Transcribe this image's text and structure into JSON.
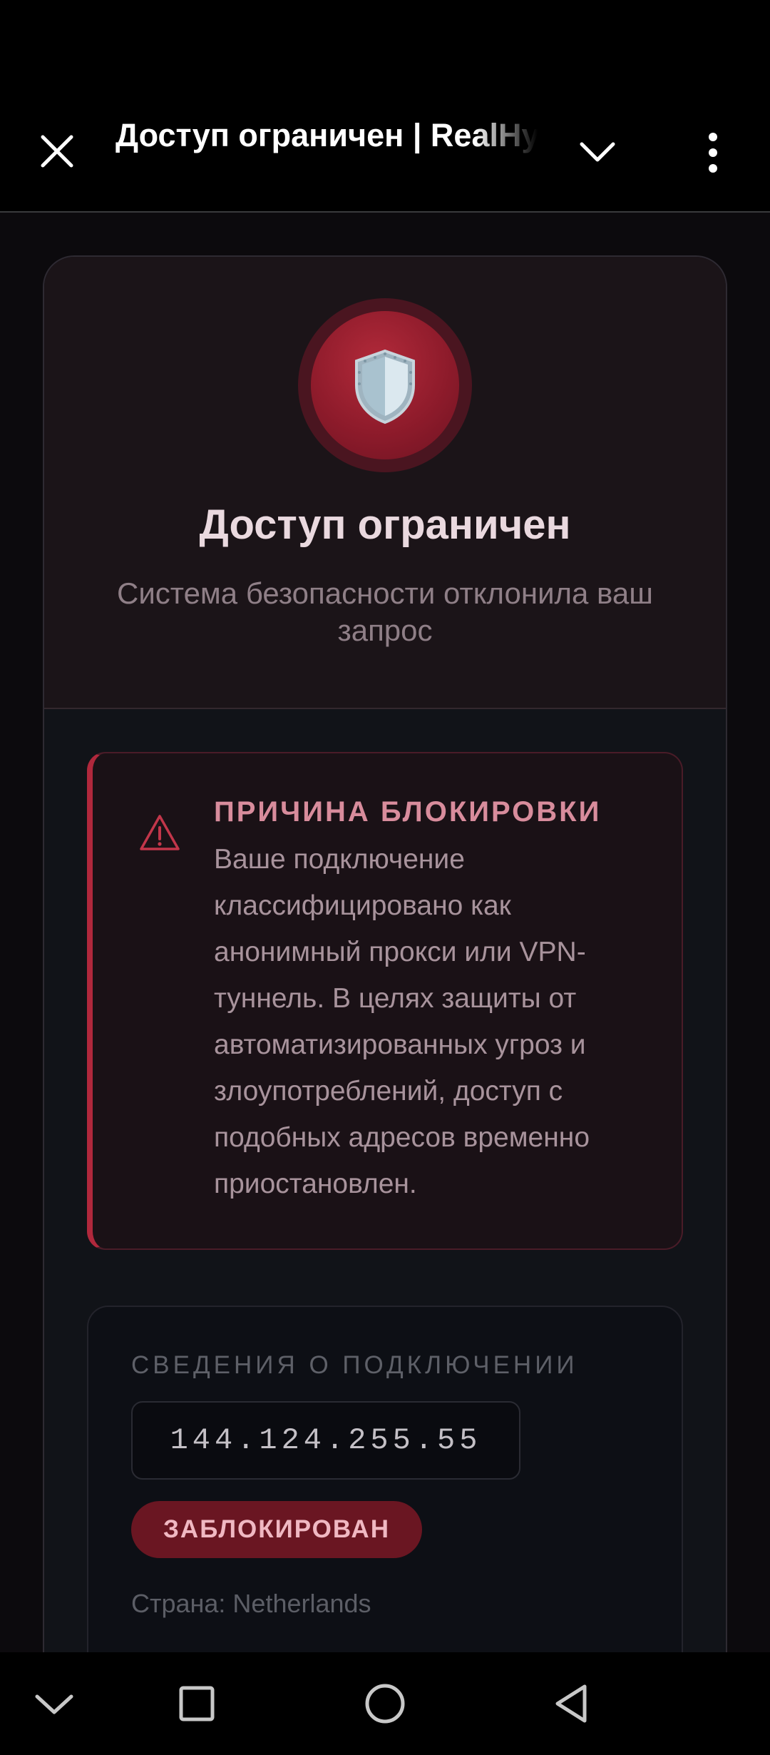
{
  "toolbar": {
    "title": "Доступ ограничен | RealHy",
    "close_icon": "close-icon",
    "expand_icon": "chevron-down-icon",
    "menu_icon": "more-vert-icon"
  },
  "header": {
    "badge_icon": "shield-icon",
    "title": "Доступ ограничен",
    "subtitle": "Система безопасности отклонила ваш запрос"
  },
  "reason": {
    "icon": "warning-icon",
    "title": "ПРИЧИНА БЛОКИРОВКИ",
    "text": "Ваше подключение классифицировано как анонимный прокси или VPN-туннель. В целях защиты от автоматизированных угроз и злоупотреблений, доступ с подобных адресов временно приостановлен."
  },
  "connection": {
    "label": "СВЕДЕНИЯ О ПОДКЛЮЧЕНИИ",
    "ip": "144.124.255.55",
    "status": "ЗАБЛОКИРОВАН",
    "country": "Страна: Netherlands"
  },
  "navbar": {
    "buttons": [
      "hide-keyboard-icon",
      "recents-square-icon",
      "home-circle-icon",
      "back-triangle-icon"
    ]
  },
  "colors": {
    "accent": "#b0283c",
    "status_bg": "#6a1622",
    "title_text": "#ead9df"
  }
}
